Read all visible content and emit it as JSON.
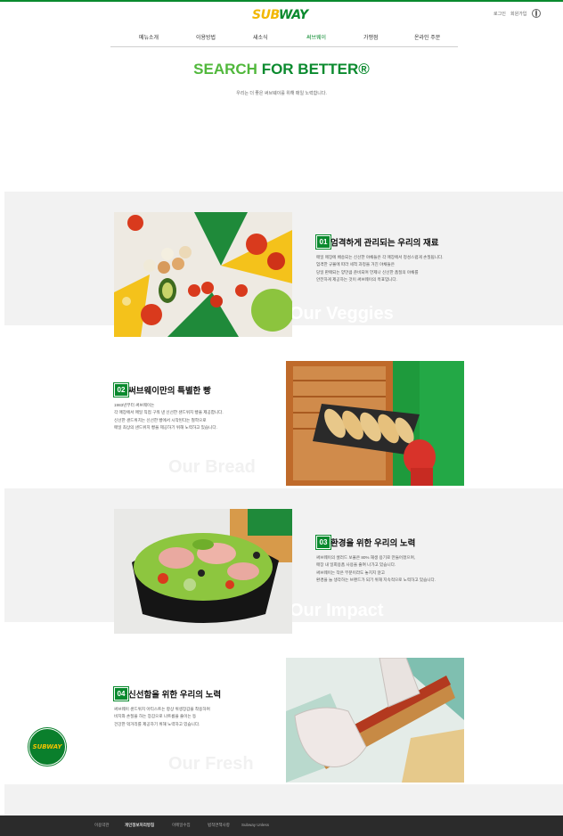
{
  "header": {
    "logo_y": "SUB",
    "logo_g": "WAY",
    "login": "로그인",
    "join": "회원가입"
  },
  "nav": [
    {
      "label": "메뉴소개"
    },
    {
      "label": "이용방법"
    },
    {
      "label": "새소식"
    },
    {
      "label": "써브웨이"
    },
    {
      "label": "가맹점"
    },
    {
      "label": "온라인 주문"
    }
  ],
  "hero": {
    "title_a": "SEARCH",
    "title_b": "FOR BETTER®",
    "subtitle": "우리는 더 좋은 써브웨이를 위해 매일 노력합니다."
  },
  "sections": [
    {
      "num": "01",
      "title": "엄격하게 관리되는 우리의 재료",
      "lines": [
        "매일 매장에 배송되는 신선한 야채들은 각 매장에서 정성스럽게 손질됩니다.",
        "엄격한 규율에 따라 세척 과정을 거친 야채들은",
        "당일 판매되는 양만큼 준비되며 언제나 신선한 품질의 야채를",
        "안전하게 제공하는 것이 써브웨이의 목표입니다."
      ],
      "ghost": "Our Veggies"
    },
    {
      "num": "02",
      "title": "써브웨이만의 특별한 빵",
      "lines": [
        "1983년부터 써브웨이는",
        "각 매장에서 매일 직접 구워 낸 신선한 샌드위치 빵을 제공합니다.",
        "신선한 샌드위치는 신선한 빵에서 시작된다는 철학으로",
        "매일 최상의 샌드위치 빵을 제공하기 위해 노력하고 있습니다."
      ],
      "ghost": "Our Bread"
    },
    {
      "num": "03",
      "title": "환경을 위한 우리의 노력",
      "lines": [
        "써브웨이의 샐러드 보울은 80% 재생 용기로 만들어졌으며,",
        "매장 내 일회용품 사용을 줄여 나가고 있습니다.",
        "써브웨이는 작은 부분이라도 놓치지 않고",
        "환경을 늘 생각하는 브랜드가 되기 위해 지속적으로 노력하고 있습니다."
      ],
      "ghost": "Our Impact"
    },
    {
      "num": "04",
      "title": "신선함을 위한 우리의 노력",
      "lines": [
        "써브웨이 샌드위치 아티스트는 항상 위생장갑을 착용하며",
        "써브웨이 빵은 언제나 정성스레 포장되어 있지 않으며",
        "비치와 손질을 하는 장갑으로 나트륨을 줄이는 등",
        "건강한 먹거리를 제공하기 위해 노력하고 있습니다."
      ],
      "ghost": "Our Fresh"
    }
  ],
  "footer": {
    "links": [
      "이용약관",
      "개인정보처리방침",
      "이메일수집",
      "법적면책사항",
      "Subway Unless"
    ]
  },
  "badge": "SUBWAY",
  "colors": {
    "brand_green": "#0a8a2e",
    "brand_yellow": "#f2b705",
    "light_green": "#51b83c"
  }
}
